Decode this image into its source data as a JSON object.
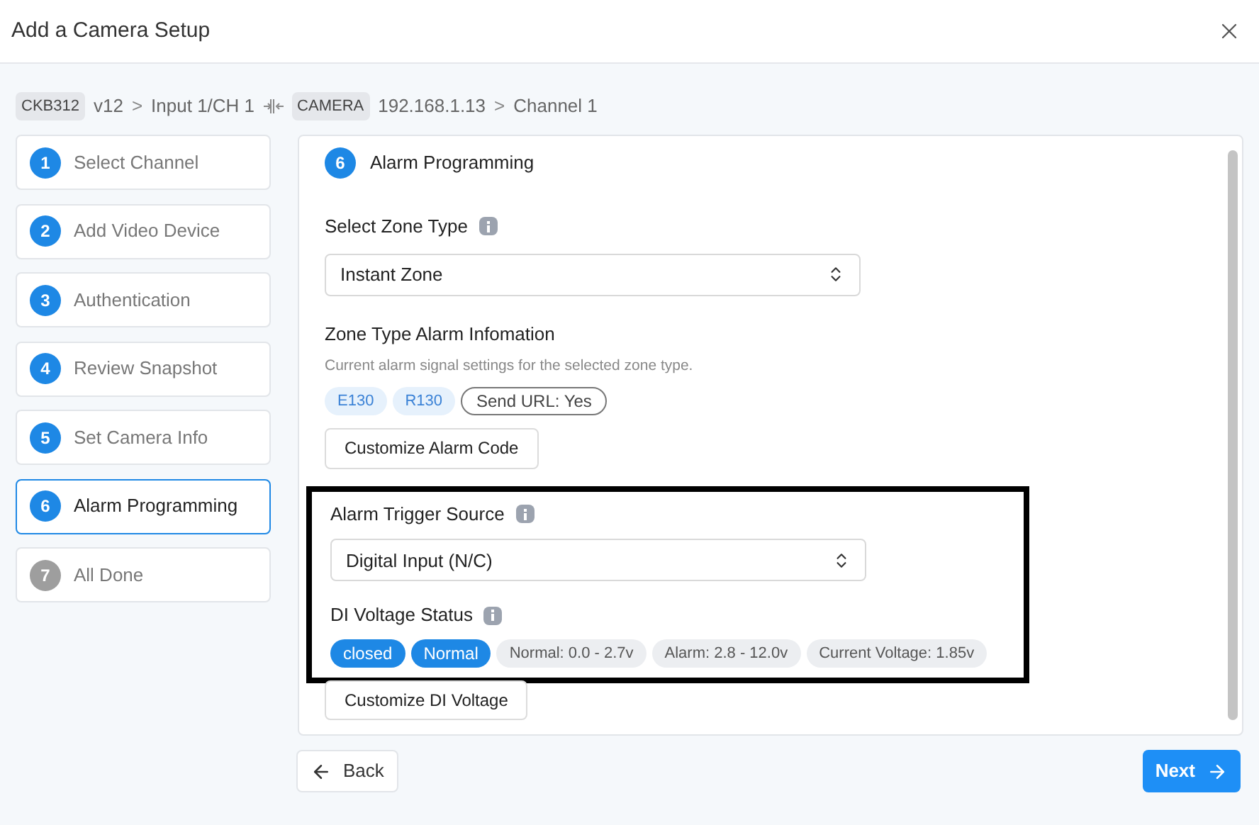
{
  "window": {
    "title": "Add a Camera Setup"
  },
  "breadcrumb": [
    {
      "kind": "tag",
      "text": "CKB312"
    },
    {
      "kind": "text",
      "text": "v12"
    },
    {
      "kind": "chevron",
      "text": ">"
    },
    {
      "kind": "text",
      "text": "Input 1/CH 1"
    },
    {
      "kind": "link"
    },
    {
      "kind": "tag",
      "text": "CAMERA"
    },
    {
      "kind": "text",
      "text": "192.168.1.13"
    },
    {
      "kind": "chevron",
      "text": ">"
    },
    {
      "kind": "text",
      "text": "Channel 1"
    }
  ],
  "steps": [
    {
      "number": "1",
      "label": "Select Channel",
      "selected": false,
      "done": true
    },
    {
      "number": "2",
      "label": "Add Video Device",
      "selected": false,
      "done": true
    },
    {
      "number": "3",
      "label": "Authentication",
      "selected": false,
      "done": true
    },
    {
      "number": "4",
      "label": "Review Snapshot",
      "selected": false,
      "done": true
    },
    {
      "number": "5",
      "label": "Set Camera Info",
      "selected": false,
      "done": true
    },
    {
      "number": "6",
      "label": "Alarm Programming",
      "selected": true,
      "done": true
    },
    {
      "number": "7",
      "label": "All Done",
      "selected": false,
      "done": false
    }
  ],
  "panel": {
    "number": "6",
    "title": "Alarm Programming",
    "zone_type": {
      "label": "Select Zone Type",
      "value": "Instant Zone"
    },
    "alarm_info": {
      "title": "Zone Type Alarm Infomation",
      "description": "Current alarm signal settings for the selected zone type.",
      "tags": [
        {
          "kind": "code",
          "text": "E130"
        },
        {
          "kind": "code",
          "text": "R130"
        },
        {
          "kind": "outline",
          "text": "Send URL: Yes"
        }
      ],
      "button": "Customize Alarm Code"
    },
    "trigger": {
      "highlighted": true,
      "label": "Alarm Trigger Source",
      "value": "Digital Input (N/C)",
      "status_label": "DI Voltage Status",
      "tags": [
        {
          "kind": "state",
          "text": "closed"
        },
        {
          "kind": "state",
          "text": "Normal"
        },
        {
          "kind": "info",
          "text": "Normal: 0.0 - 2.7v"
        },
        {
          "kind": "info",
          "text": "Alarm: 2.8 - 12.0v"
        },
        {
          "kind": "info",
          "text": "Current Voltage: 1.85v"
        }
      ]
    },
    "voltage_button": "Customize DI Voltage"
  },
  "footer": {
    "back": "Back",
    "next": "Next"
  }
}
